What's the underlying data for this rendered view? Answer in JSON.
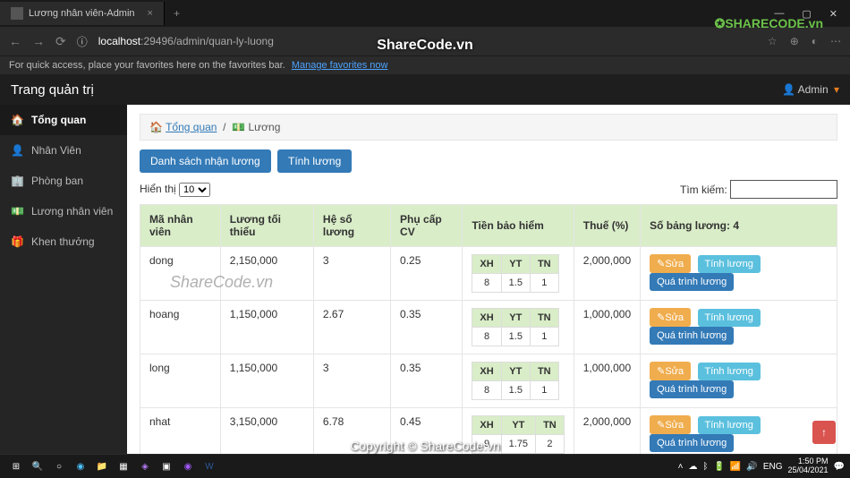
{
  "browser": {
    "tab_title": "Lương nhân viên-Admin",
    "url_host": "localhost",
    "url_port": ":29496",
    "url_path": "/admin/quan-ly-luong",
    "fav_text": "For quick access, place your favorites here on the favorites bar.",
    "fav_link": "Manage favorites now"
  },
  "watermarks": {
    "sharecode": "SHARECODE.vn",
    "center": "ShareCode.vn",
    "middle": "ShareCode.vn",
    "copyright": "Copyright © ShareCode.vn"
  },
  "app": {
    "title": "Trang quản trị",
    "user": "Admin"
  },
  "sidebar": [
    {
      "icon": "dashboard-icon",
      "label": "Tổng quan",
      "active": true
    },
    {
      "icon": "user-icon",
      "label": "Nhân Viên"
    },
    {
      "icon": "building-icon",
      "label": "Phòng ban"
    },
    {
      "icon": "money-icon",
      "label": "Lương nhân viên"
    },
    {
      "icon": "gift-icon",
      "label": "Khen thưởng"
    }
  ],
  "breadcrumb": {
    "home": "Tổng quan",
    "current": "Lương"
  },
  "buttons": {
    "list": "Danh sách nhận lương",
    "calc": "Tính lương"
  },
  "controls": {
    "show_label": "Hiển thị",
    "show_value": "10",
    "search_label": "Tìm kiếm:"
  },
  "table": {
    "count_label": "Số bảng lương: 4",
    "headers": {
      "ma": "Mã nhân viên",
      "luong": "Lương tối thiểu",
      "heso": "Hệ số lương",
      "phucap": "Phụ cấp CV",
      "baohiem": "Tiền bảo hiểm",
      "thue": "Thuế (%)"
    },
    "mini_headers": {
      "xh": "XH",
      "yt": "YT",
      "tn": "TN"
    },
    "actions": {
      "sua": "Sửa",
      "tinh": "Tính lương",
      "qua": "Quá trình lương"
    },
    "rows": [
      {
        "ma": "dong",
        "luong": "2,150,000",
        "heso": "3",
        "phucap": "0.25",
        "xh": "8",
        "yt": "1.5",
        "tn": "1",
        "thue": "2,000,000"
      },
      {
        "ma": "hoang",
        "luong": "1,150,000",
        "heso": "2.67",
        "phucap": "0.35",
        "xh": "8",
        "yt": "1.5",
        "tn": "1",
        "thue": "1,000,000"
      },
      {
        "ma": "long",
        "luong": "1,150,000",
        "heso": "3",
        "phucap": "0.35",
        "xh": "8",
        "yt": "1.5",
        "tn": "1",
        "thue": "1,000,000"
      },
      {
        "ma": "nhat",
        "luong": "3,150,000",
        "heso": "6.78",
        "phucap": "0.45",
        "xh": "9",
        "yt": "1.75",
        "tn": "2",
        "thue": "2,000,000"
      }
    ]
  },
  "taskbar": {
    "time": "1:50 PM",
    "date": "25/04/2021",
    "lang": "ENG"
  }
}
